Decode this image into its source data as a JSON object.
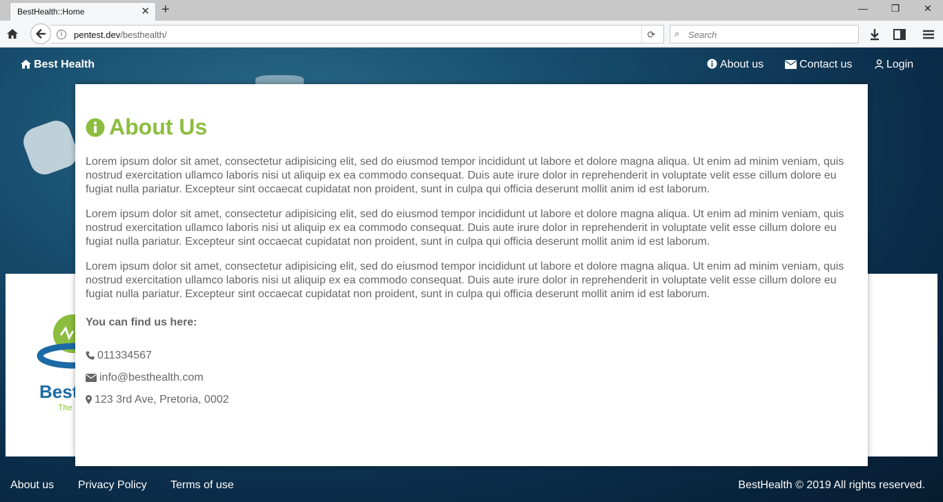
{
  "browser": {
    "tab_title": "BestHealth::Home",
    "tab_close": "✕",
    "new_tab": "+",
    "url_host": "pentest.dev",
    "url_path": "/besthealth/",
    "search_placeholder": "Search",
    "window": {
      "minimize": "—",
      "restore": "❐",
      "close": "✕"
    }
  },
  "site_nav": {
    "brand": "Best Health",
    "about": "About us",
    "contact": "Contact us",
    "login": "Login"
  },
  "about": {
    "heading": "About Us",
    "paragraphs": [
      "Lorem ipsum dolor sit amet, consectetur adipisicing elit, sed do eiusmod tempor incididunt ut labore et dolore magna aliqua. Ut enim ad minim veniam, quis nostrud exercitation ullamco laboris nisi ut aliquip ex ea commodo consequat. Duis aute irure dolor in reprehenderit in voluptate velit esse cillum dolore eu fugiat nulla pariatur. Excepteur sint occaecat cupidatat non proident, sunt in culpa qui officia deserunt mollit anim id est laborum.",
      "Lorem ipsum dolor sit amet, consectetur adipisicing elit, sed do eiusmod tempor incididunt ut labore et dolore magna aliqua. Ut enim ad minim veniam, quis nostrud exercitation ullamco laboris nisi ut aliquip ex ea commodo consequat. Duis aute irure dolor in reprehenderit in voluptate velit esse cillum dolore eu fugiat nulla pariatur. Excepteur sint occaecat cupidatat non proident, sunt in culpa qui officia deserunt mollit anim id est laborum.",
      "Lorem ipsum dolor sit amet, consectetur adipisicing elit, sed do eiusmod tempor incididunt ut labore et dolore magna aliqua. Ut enim ad minim veniam, quis nostrud exercitation ullamco laboris nisi ut aliquip ex ea commodo consequat. Duis aute irure dolor in reprehenderit in voluptate velit esse cillum dolore eu fugiat nulla pariatur. Excepteur sint occaecat cupidatat non proident, sunt in culpa qui officia deserunt mollit anim id est laborum."
    ],
    "find_us": "You can find us here:",
    "phone": "011334567",
    "email": "info@besthealth.com",
    "address": "123 3rd Ave, Pretoria, 0002"
  },
  "footer": {
    "about": "About us",
    "privacy": "Privacy Policy",
    "terms": "Terms of use",
    "copyright": "BestHealth © 2019 All rights reserved."
  },
  "colors": {
    "accent_green": "#8cbd3f",
    "body_text": "#666666",
    "logo_blue": "#1b6aa5"
  },
  "background_logo_fragment": "Best The"
}
